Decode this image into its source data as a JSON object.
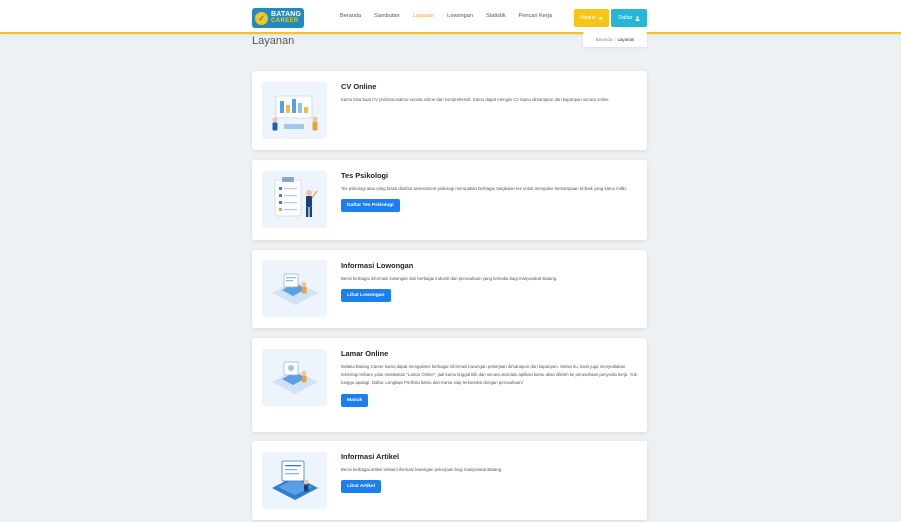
{
  "brand": {
    "line1": "BATANG",
    "line2": "CAREER"
  },
  "nav": {
    "items": [
      {
        "label": "Beranda",
        "active": false
      },
      {
        "label": "Sambutan",
        "active": false
      },
      {
        "label": "Layanan",
        "active": true
      },
      {
        "label": "Lowongan",
        "active": false
      },
      {
        "label": "Statistik",
        "active": false
      },
      {
        "label": "Pencari Kerja",
        "active": false
      }
    ],
    "login_label": "Masuk",
    "register_label": "Daftar"
  },
  "page": {
    "title": "Layanan"
  },
  "breadcrumb": {
    "home": "Beranda",
    "separator": "/",
    "current": "Layanan"
  },
  "services": [
    {
      "title": "CV Online",
      "description": "Kamu bisa buat CV professionalmu secara online dan komprehensif. Kamu dapat mengisi CV kamu dimanapun dan kapanpun secara online.",
      "action": ""
    },
    {
      "title": "Tes Psikologi",
      "description": "Tes psikologi atau yang biasa disebut assessment psikologi merupakan berbagai rangkaian tes untuk mengukur kemampuan terbaik yang kamu miliki.",
      "action": "Daftar Tes Psikologi"
    },
    {
      "title": "Informasi Lowongan",
      "description": "Berisi berbagai informasi lowongan dari berbagai industri dan perusahaan yang tersedia bagi masyarakat Batang.",
      "action": "Lihat Lowongan"
    },
    {
      "title": "Lamar Online",
      "description": "Melalui Batang Career kamu dapat mengakses berbagai informasi lowongan pekerjaan dimanapun dan kapanpun. Selain itu, kami juga menyediakan teknologi terbaru yaitu melakukan \"Lamar Online\", jadi kamu tinggal klik dan secara otomatis aplikasi kamu akan dikirim ke perusahaan penyedia kerja. Yuk tunggu apalagi, Daftar, Lengkapi Portfolio kamu dan Kamu siap terkoneksi dengan perusahaan!",
      "action": "Masuk"
    },
    {
      "title": "Informasi Artikel",
      "description": "Berisi berbagai artikel terkait informasi lowongan pekerjaan bagi masyarakat Batang.",
      "action": "Lihat Artikel"
    }
  ],
  "colors": {
    "accent": "#f5c518",
    "primary": "#1b7ff0",
    "info": "#29b6d6"
  }
}
